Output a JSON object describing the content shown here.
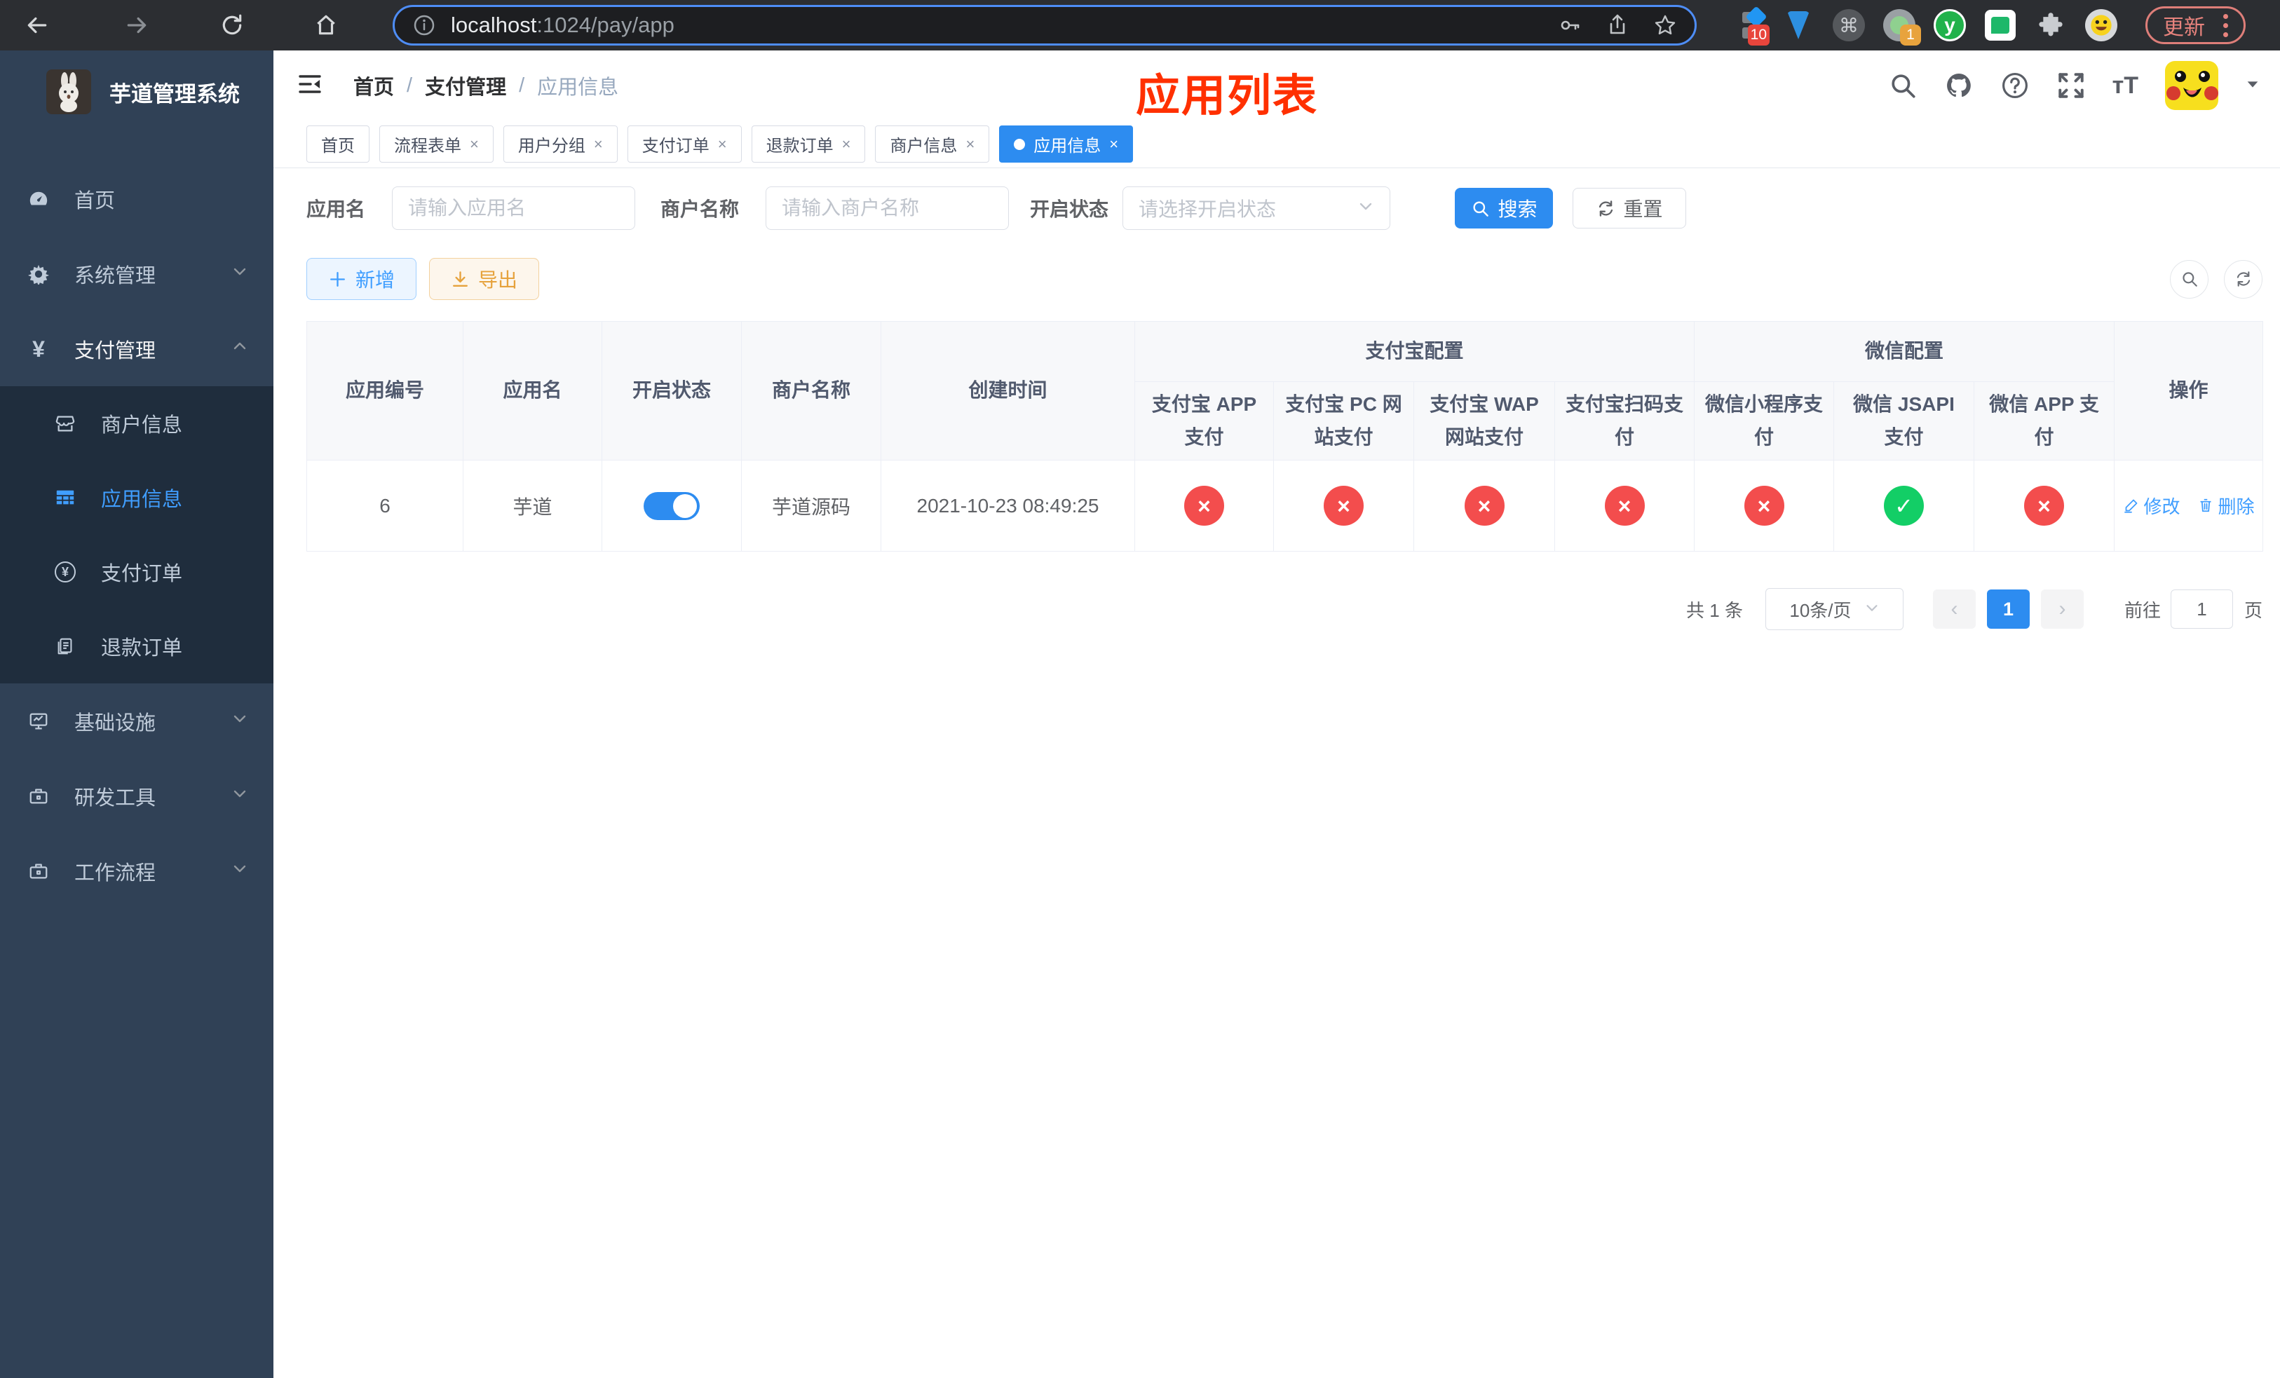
{
  "colors": {
    "primary": "#2d8cf0",
    "link": "#409eff",
    "success": "#13ce66",
    "danger": "#f34d4d",
    "warning": "#e6a23c",
    "sidebar_bg": "#304156",
    "submenu_bg": "#1f2d3d",
    "annotation_red": "#ff3000"
  },
  "browser": {
    "url_host": "localhost",
    "url_path": ":1024/pay/app",
    "ext_badge_blocker": "10",
    "ext_badge_recorder": "1",
    "ext_letter": "y",
    "cmd_glyph": "⌘",
    "update_label": "更新"
  },
  "sidebar": {
    "title": "芋道管理系统",
    "items": [
      {
        "label": "首页"
      },
      {
        "label": "系统管理"
      },
      {
        "label": "支付管理"
      },
      {
        "label": "商户信息"
      },
      {
        "label": "应用信息"
      },
      {
        "label": "支付订单"
      },
      {
        "label": "退款订单"
      },
      {
        "label": "基础设施"
      },
      {
        "label": "研发工具"
      },
      {
        "label": "工作流程"
      }
    ]
  },
  "header": {
    "breadcrumb": [
      "首页",
      "支付管理",
      "应用信息"
    ],
    "separator": "/",
    "annotation": "应用列表"
  },
  "tabs": [
    {
      "label": "首页"
    },
    {
      "label": "流程表单"
    },
    {
      "label": "用户分组"
    },
    {
      "label": "支付订单"
    },
    {
      "label": "退款订单"
    },
    {
      "label": "商户信息"
    },
    {
      "label": "应用信息"
    }
  ],
  "tab_close_glyph": "×",
  "filters": {
    "app_name_label": "应用名",
    "app_name_placeholder": "请输入应用名",
    "merchant_label": "商户名称",
    "merchant_placeholder": "请输入商户名称",
    "status_label": "开启状态",
    "status_placeholder": "请选择开启状态",
    "search_label": "搜索",
    "reset_label": "重置"
  },
  "toolbar": {
    "add_label": "新增",
    "export_label": "导出"
  },
  "table": {
    "group_alipay": "支付宝配置",
    "group_wechat": "微信配置",
    "col_app_id": "应用编号",
    "col_app_name": "应用名",
    "col_status": "开启状态",
    "col_merchant": "商户名称",
    "col_created": "创建时间",
    "col_alipay_app": "支付宝 APP 支付",
    "col_alipay_pc": "支付宝 PC 网站支付",
    "col_alipay_wap": "支付宝 WAP 网站支付",
    "col_alipay_qr": "支付宝扫码支付",
    "col_wx_lite": "微信小程序支付",
    "col_wx_jsapi": "微信 JSAPI 支付",
    "col_wx_app": "微信 APP 支付",
    "col_ops": "操作",
    "glyph_success": "✓",
    "glyph_fail": "×",
    "row": {
      "app_id": "6",
      "app_name": "芋道",
      "status_on": true,
      "merchant": "芋道源码",
      "created": "2021-10-23 08:49:25",
      "configs": [
        "no",
        "no",
        "no",
        "no",
        "no",
        "yes",
        "no"
      ],
      "edit_label": "修改",
      "delete_label": "删除"
    }
  },
  "pagination": {
    "total_label": "共 1 条",
    "page_size": "10条/页",
    "current_page": "1",
    "goto_label": "前往",
    "goto_value": "1",
    "page_suffix": "页"
  }
}
